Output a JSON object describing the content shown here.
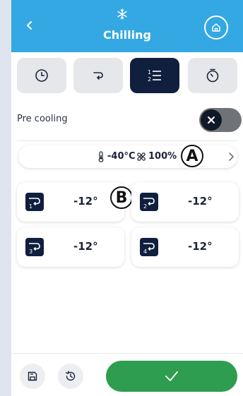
{
  "header": {
    "title": "Chilling",
    "icons": {
      "back": "chevron-left-icon",
      "mode": "snowflake-icon",
      "home": "home-icon"
    },
    "color": "#34a8e2"
  },
  "tabs": [
    {
      "name": "clock",
      "icon": "clock-icon",
      "active": false
    },
    {
      "name": "probe",
      "icon": "probe-icon",
      "active": false
    },
    {
      "name": "phases",
      "icon": "phases-list-icon",
      "active": true
    },
    {
      "name": "timer",
      "icon": "stopwatch-icon",
      "active": false
    }
  ],
  "precooling": {
    "label": "Pre cooling",
    "enabled": false
  },
  "params": {
    "temperature": "-40°C",
    "fan": "100%"
  },
  "markers": {
    "a": "A",
    "b": "B"
  },
  "phases": [
    {
      "index": "1",
      "temp": "-12°"
    },
    {
      "index": "2",
      "temp": "-12°"
    },
    {
      "index": "3",
      "temp": "-12°"
    },
    {
      "index": "4",
      "temp": "-12°"
    }
  ],
  "footer": {
    "icons": {
      "save": "save-icon",
      "history": "history-icon",
      "confirm": "check-icon"
    },
    "confirm_color": "#2e9d4f"
  }
}
